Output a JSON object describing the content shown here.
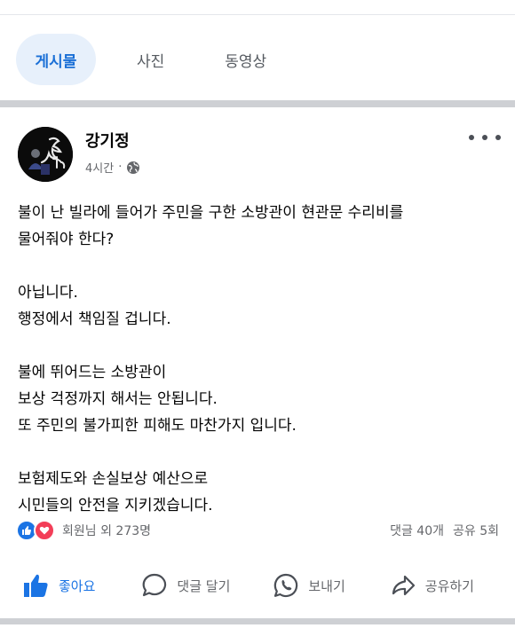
{
  "tabs": [
    {
      "label": "게시물"
    },
    {
      "label": "사진"
    },
    {
      "label": "동영상"
    }
  ],
  "post": {
    "author": "강기정",
    "time": "4시간",
    "dot": "·",
    "privacy_icon": "globe-icon",
    "paragraphs": [
      [
        "불이 난 빌라에 들어가 주민을 구한 소방관이 현관문 수리비를",
        "물어줘야 한다?"
      ],
      [
        "아닙니다.",
        "행정에서 책임질 겁니다."
      ],
      [
        "불에 뛰어드는 소방관이",
        "보상 걱정까지 해서는 안됩니다.",
        "또 주민의 불가피한 피해도 마찬가지 입니다."
      ],
      [
        "보험제도와 손실보상 예산으로",
        "시민들의 안전을 지키겠습니다."
      ]
    ],
    "reactions_label": "회원님 외 273명",
    "comments_count": "댓글 40개",
    "shares_count": "공유 5회"
  },
  "actions": {
    "like": "좋아요",
    "comment": "댓글 달기",
    "send": "보내기",
    "share": "공유하기"
  },
  "colors": {
    "accent": "#1b74e4",
    "heart": "#f33e58",
    "tab_active_bg": "#e7f0fb"
  }
}
